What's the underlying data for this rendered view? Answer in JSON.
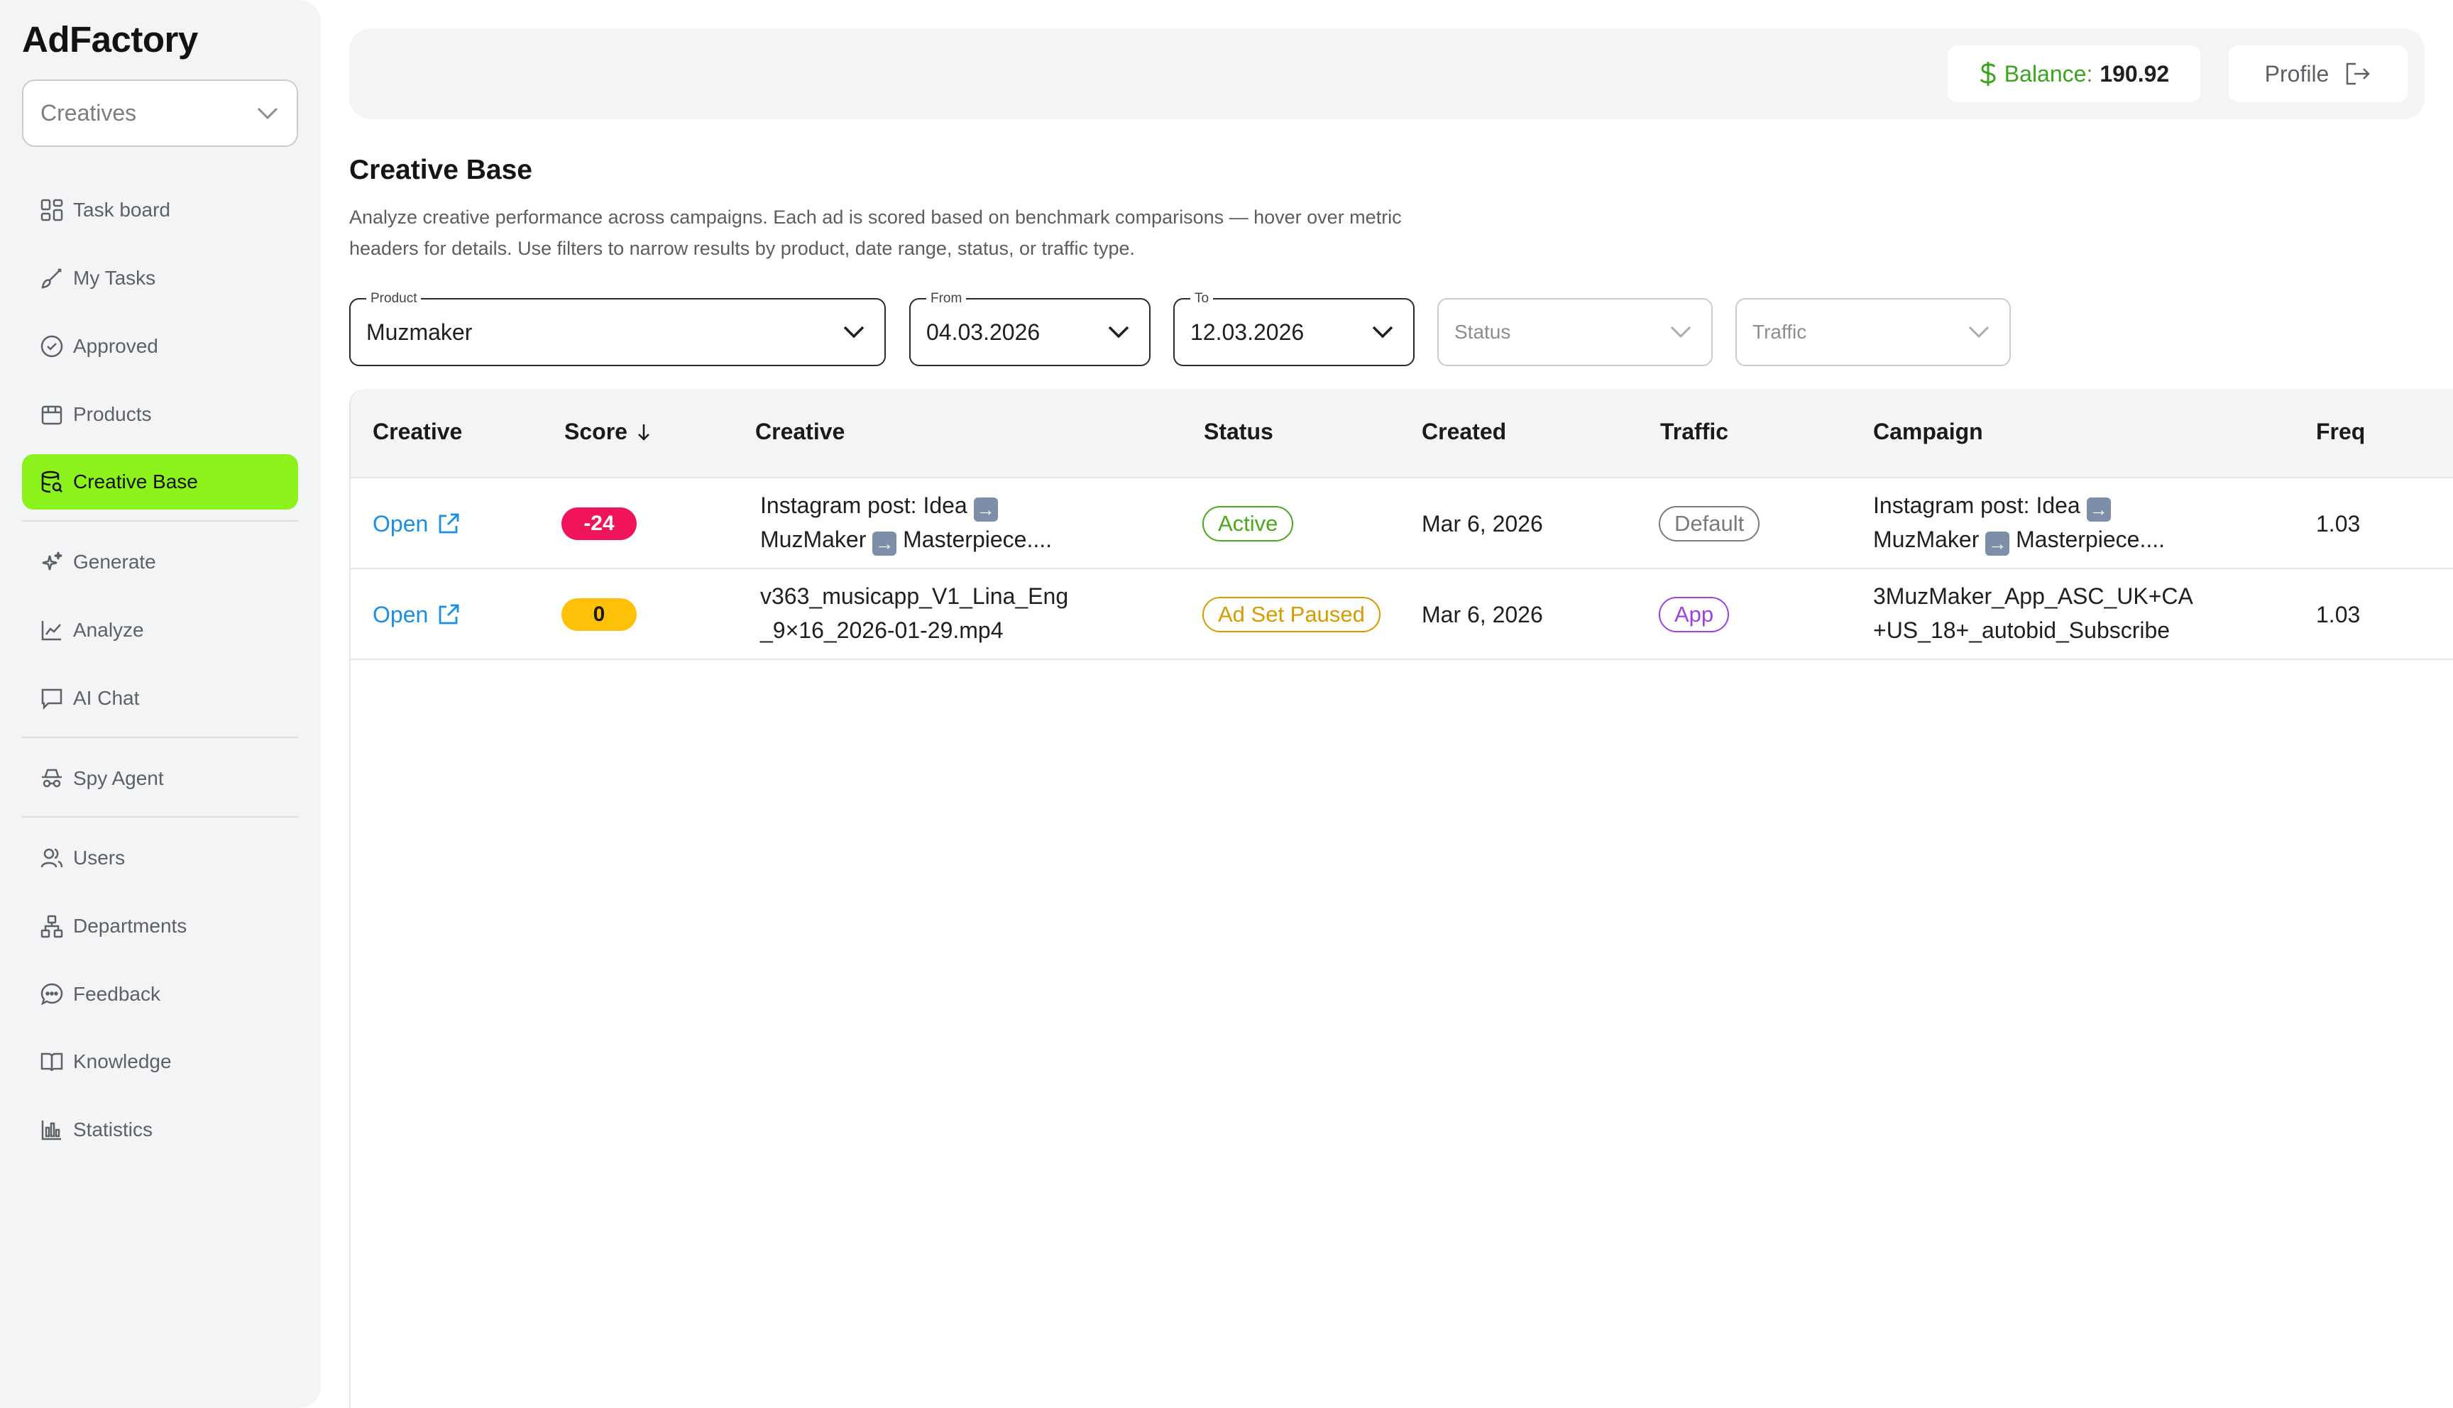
{
  "app": {
    "logo": "AdFactory"
  },
  "sidebar": {
    "workspace_select": "Creatives",
    "items": [
      {
        "label": "Task board",
        "icon": "grid-icon"
      },
      {
        "label": "My Tasks",
        "icon": "brush-icon"
      },
      {
        "label": "Approved",
        "icon": "check-circle-icon"
      },
      {
        "label": "Products",
        "icon": "box-icon"
      },
      {
        "label": "Creative Base",
        "icon": "database-search-icon",
        "active": true
      },
      {
        "label": "Generate",
        "icon": "sparkles-icon"
      },
      {
        "label": "Analyze",
        "icon": "chart-line-icon"
      },
      {
        "label": "AI Chat",
        "icon": "chat-icon"
      },
      {
        "label": "Spy Agent",
        "icon": "spy-icon"
      },
      {
        "label": "Users",
        "icon": "users-icon"
      },
      {
        "label": "Departments",
        "icon": "hierarchy-icon"
      },
      {
        "label": "Feedback",
        "icon": "feedback-icon"
      },
      {
        "label": "Knowledge",
        "icon": "book-icon"
      },
      {
        "label": "Statistics",
        "icon": "bar-chart-icon"
      }
    ]
  },
  "topbar": {
    "balance_label": "Balance:",
    "balance_value": "190.92",
    "profile_label": "Profile"
  },
  "page": {
    "title": "Creative Base",
    "description": "Analyze creative performance across campaigns. Each ad is scored based on benchmark comparisons — hover over metric headers for details. Use filters to narrow results by product, date range, status, or traffic type."
  },
  "filters": {
    "product": {
      "label": "Product",
      "value": "Muzmaker"
    },
    "from": {
      "label": "From",
      "value": "04.03.2026"
    },
    "to": {
      "label": "To",
      "value": "12.03.2026"
    },
    "status": {
      "placeholder": "Status"
    },
    "traffic": {
      "placeholder": "Traffic"
    }
  },
  "table": {
    "headers": [
      "Creative",
      "Score",
      "Creative",
      "Status",
      "Created",
      "Traffic",
      "Campaign",
      "Freq"
    ],
    "rows": [
      {
        "open": "Open",
        "score": "-24",
        "creative_line1": "Instagram post: Idea",
        "creative_line2": "MuzMaker",
        "creative_line2b": "Masterpiece....",
        "status": "Active",
        "created": "Mar 6, 2026",
        "traffic": "Default",
        "campaign_line1": "Instagram post: Idea",
        "campaign_line2": "MuzMaker",
        "campaign_line2b": "Masterpiece....",
        "freq": "1.03"
      },
      {
        "open": "Open",
        "score": "0",
        "creative_line1": "v363_musicapp_V1_Lina_Eng",
        "creative_line2": "_9×16_2026-01-29.mp4",
        "status": "Ad Set Paused",
        "created": "Mar 6, 2026",
        "traffic": "App",
        "campaign_line1": "3MuzMaker_App_ASC_UK+CA",
        "campaign_line2": "+US_18+_autobid_Subscribe",
        "freq": "1.03"
      }
    ]
  },
  "colors": {
    "accent_green": "#8cf21b",
    "score_negative": "#f0145a",
    "score_neutral": "#ffc107",
    "status_active": "#4aa81a",
    "status_paused": "#d99a00",
    "traffic_default": "#777a7e",
    "traffic_app": "#a23fe0",
    "link_blue": "#1a8fe3"
  }
}
